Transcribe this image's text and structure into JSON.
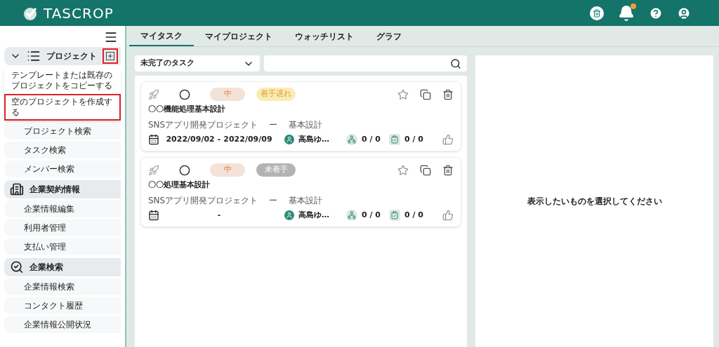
{
  "header": {
    "logo": "TASCROP",
    "notification_badge": true
  },
  "sidebar": {
    "groups": [
      {
        "kind": "project",
        "label": "プロジェクト",
        "expanded": true,
        "add_highlighted": true,
        "items": [
          "プロジェクト検索",
          "タスク検索",
          "メンバー検索"
        ]
      },
      {
        "kind": "building",
        "label": "企業契約情報",
        "items": [
          "企業情報編集",
          "利用者管理",
          "支払い管理"
        ]
      },
      {
        "kind": "search",
        "label": "企業検索",
        "items": [
          "企業情報検索",
          "コンタクト履歴",
          "企業情報公開状況"
        ]
      }
    ],
    "popup_menu": [
      {
        "label": "テンプレートまたは既存のプロジェクトをコピーする",
        "highlighted": false
      },
      {
        "label": "空のプロジェクトを作成する",
        "highlighted": true
      }
    ]
  },
  "tabs": [
    {
      "label": "マイタスク",
      "selected": true
    },
    {
      "label": "マイプロジェクト",
      "selected": false
    },
    {
      "label": "ウォッチリスト",
      "selected": false
    },
    {
      "label": "グラフ",
      "selected": false
    }
  ],
  "filter": {
    "value": "未完了のタスク"
  },
  "tasks": [
    {
      "priority": "中",
      "status": "着手遅れ",
      "color": "#f9ebb5",
      "title": "〇〇機能処理基本設計",
      "project": "SNSアプリ開発プロジェクト",
      "separator": "ー",
      "phase": "基本設計",
      "start": "2022/09/02",
      "dash": "-",
      "end": "2022/09/09",
      "assignee": "高島ゆ…",
      "members": "0 / 0",
      "checks": "0 / 0"
    },
    {
      "priority": "中",
      "status": "未着手",
      "color": "#b3b3b3",
      "title": "〇〇処理基本設計",
      "project": "SNSアプリ開発プロジェクト",
      "separator": "ー",
      "phase": "基本設計",
      "dash": "-",
      "assignee": "高島ゆ…",
      "members": "0 / 0",
      "checks": "0 / 0"
    }
  ],
  "detail": {
    "message": "表示したいものを選択してください"
  }
}
